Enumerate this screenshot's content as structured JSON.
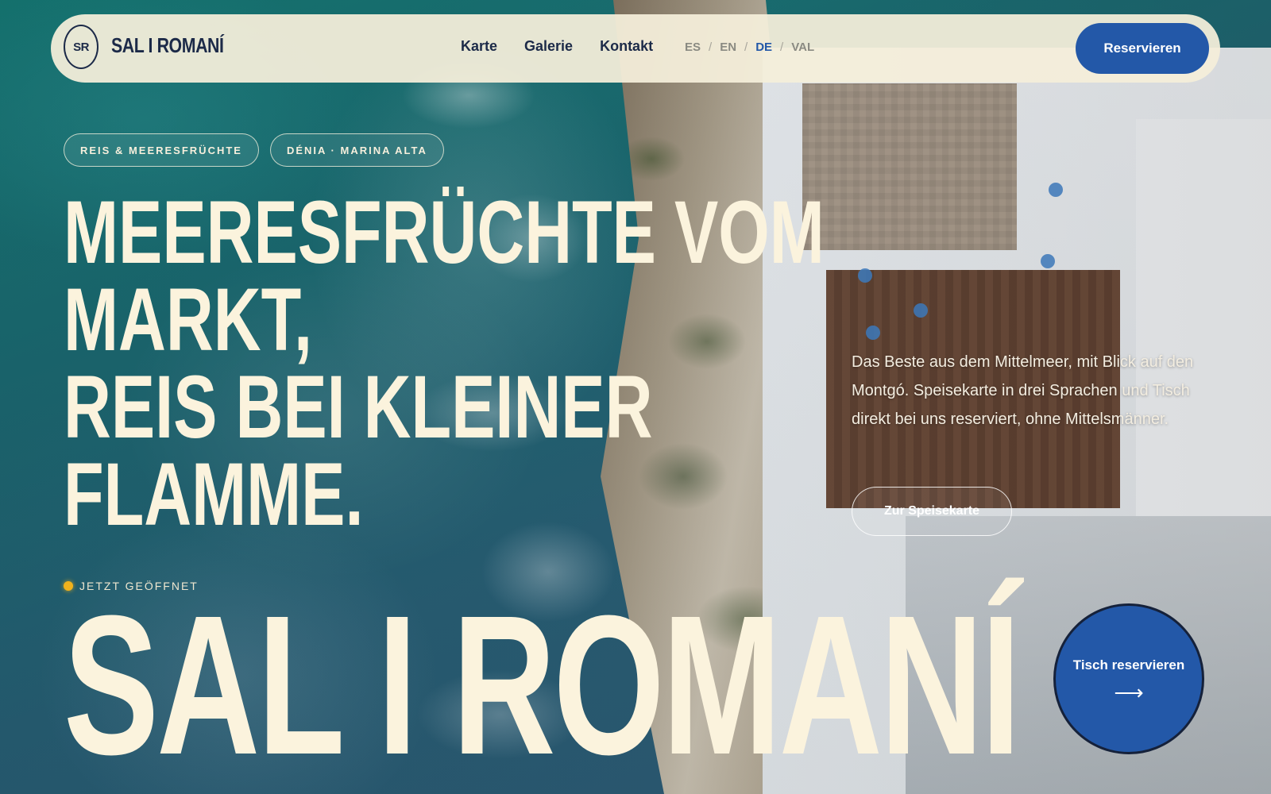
{
  "header": {
    "logo_mark": "SR",
    "brand_name": "SAL I ROMANÍ",
    "nav": [
      "Karte",
      "Galerie",
      "Kontakt"
    ],
    "languages": [
      "ES",
      "EN",
      "DE",
      "VAL"
    ],
    "active_language": "DE",
    "language_separator": "/",
    "reserve_label": "Reservieren"
  },
  "hero": {
    "tags": [
      "REIS & MEERESFRÜCHTE",
      "DÉNIA · MARINA ALTA"
    ],
    "headline_lines": [
      "MEERESFRÜCHTE VOM",
      "MARKT,",
      "REIS BEI KLEINER",
      "FLAMME."
    ],
    "description": "Das Beste aus dem Mittelmeer, mit Blick auf den Montgó. Speisekarte in drei Sprachen und Tisch direkt bei uns reserviert, ohne Mittelsmänner.",
    "menu_button_label": "Zur Speisekarte",
    "status_text": "JETZT GEÖFFNET",
    "brand_large": "SAL I ROMANÍ",
    "cta_label": "Tisch reservieren",
    "cta_arrow": "⟶"
  },
  "colors": {
    "accent_blue": "#2358a8",
    "cream": "#fbf3dd",
    "navy": "#1c2a48",
    "status_yellow": "#f1b21c"
  }
}
